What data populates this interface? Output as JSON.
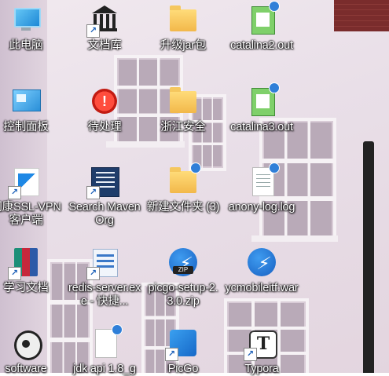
{
  "desktop": {
    "icons": [
      {
        "label": "此电脑"
      },
      {
        "label": "文档库"
      },
      {
        "label": "升级jar包"
      },
      {
        "label": "catalina2.out"
      },
      {
        "label": "控制面板"
      },
      {
        "label": "待处理"
      },
      {
        "label": "浙江安全"
      },
      {
        "label": "catalina3.out"
      },
      {
        "label": "网康SSL-VPN客户端"
      },
      {
        "label": "Search Maven Org"
      },
      {
        "label": "新建文件夹 (3)"
      },
      {
        "label": "anony-log.log"
      },
      {
        "label": "学习文档"
      },
      {
        "label": "redis-server.exe - 快捷..."
      },
      {
        "label": "picgo-setup-2.3.0.zip"
      },
      {
        "label": "ycmobileitf.war"
      },
      {
        "label": "software"
      },
      {
        "label": "jdk api 1.8_g"
      },
      {
        "label": "PicGo"
      },
      {
        "label": "Typora"
      }
    ],
    "glyphs": {
      "zip": "ZIP",
      "shortcut": "↗",
      "alert": "!",
      "typora": "T",
      "bolt": "⚡"
    }
  }
}
